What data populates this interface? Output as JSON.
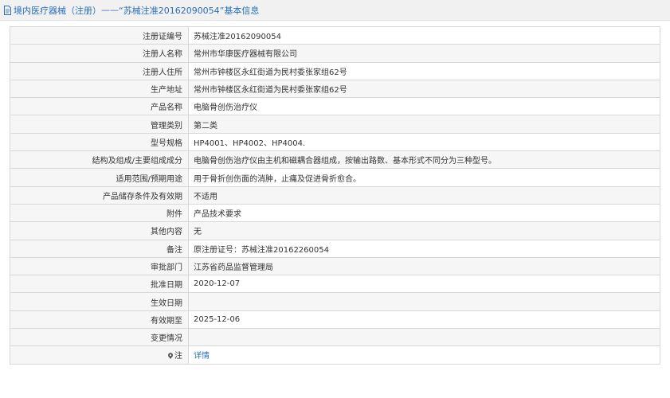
{
  "header": {
    "prefix": "境内医疗器械（注册）",
    "separator": "——",
    "reg_title": "“苏械注准20162090054”",
    "suffix": "基本信息"
  },
  "rows": [
    {
      "label": "注册证编号",
      "value": "苏械注准20162090054"
    },
    {
      "label": "注册人名称",
      "value": "常州市华康医疗器械有限公司"
    },
    {
      "label": "注册人住所",
      "value": "常州市钟楼区永红街道为民村委张家组62号"
    },
    {
      "label": "生产地址",
      "value": "常州市钟楼区永红街道为民村委张家组62号"
    },
    {
      "label": "产品名称",
      "value": "电脑骨创伤治疗仪"
    },
    {
      "label": "管理类别",
      "value": "第二类"
    },
    {
      "label": "型号规格",
      "value": "HP4001、HP4002、HP4004."
    },
    {
      "label": "结构及组成/主要组成成分",
      "value": "电脑骨创伤治疗仪由主机和磁耦合器组成，按输出路数、基本形式不同分为三种型号。"
    },
    {
      "label": "适用范围/预期用途",
      "value": "用于骨折创伤面的消肿，止痛及促进骨折愈合。"
    },
    {
      "label": "产品储存条件及有效期",
      "value": "不适用"
    },
    {
      "label": "附件",
      "value": "产品技术要求"
    },
    {
      "label": "其他内容",
      "value": "无"
    },
    {
      "label": "备注",
      "value": "原注册证号：苏械注准20162260054"
    },
    {
      "label": "审批部门",
      "value": "江苏省药品监督管理局"
    },
    {
      "label": "批准日期",
      "value": "2020-12-07"
    },
    {
      "label": "生效日期",
      "value": ""
    },
    {
      "label": "有效期至",
      "value": "2025-12-06"
    },
    {
      "label": "变更情况",
      "value": ""
    }
  ],
  "note_row": {
    "label": "注",
    "link": "详情",
    "icon": "location-pin-icon"
  },
  "colors": {
    "link": "#2a6fb8",
    "label_bg": "#f6f6f6",
    "border": "#d8d8d8"
  }
}
